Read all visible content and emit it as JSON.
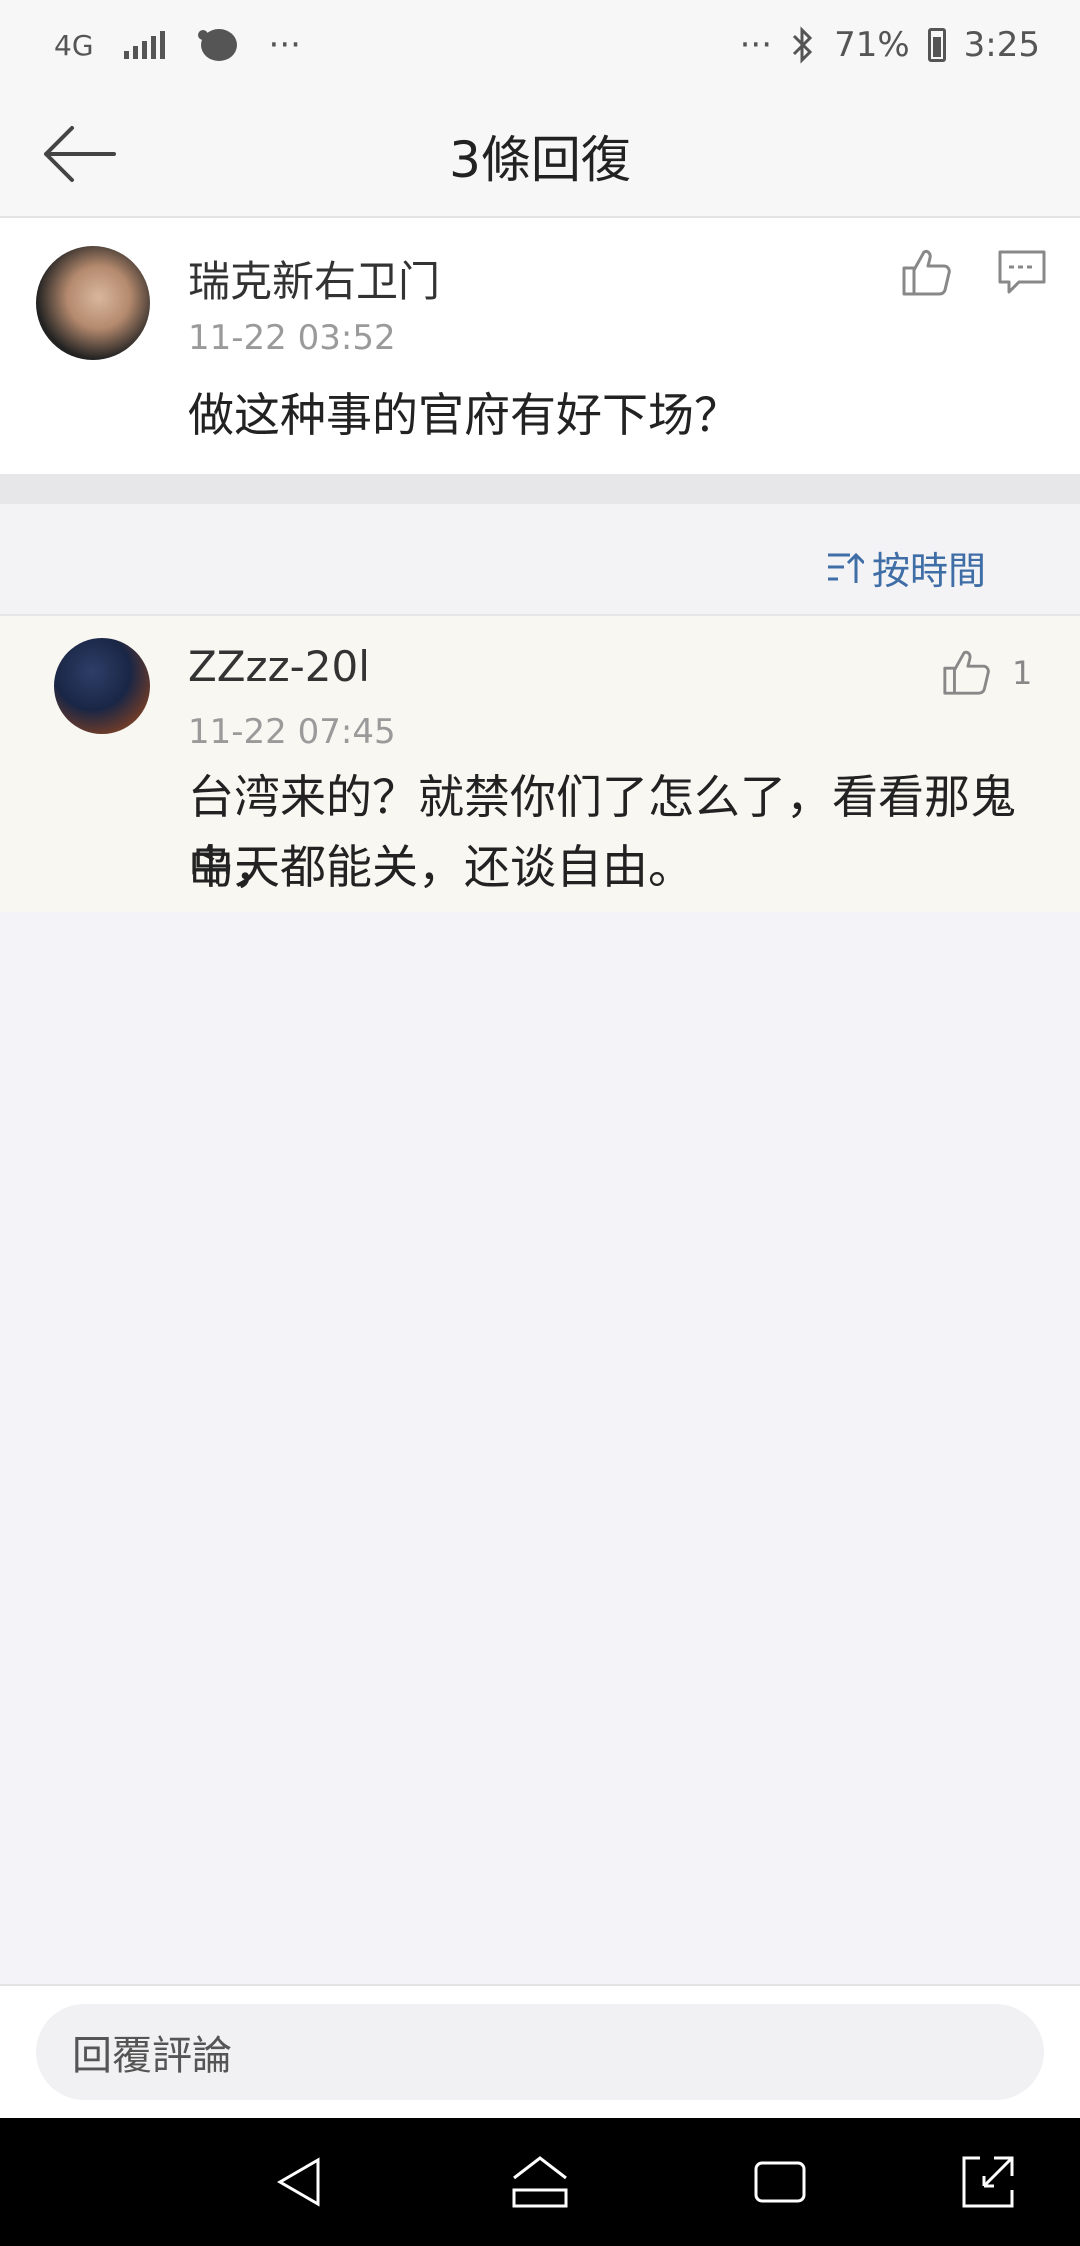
{
  "status_bar": {
    "network": "4G",
    "dots_left": "···",
    "dots_right": "···",
    "battery": "71%",
    "time": "3:25"
  },
  "header": {
    "title": "3條回復",
    "back_icon": "arrow-left-icon"
  },
  "main_comment": {
    "username": "瑞克新右卫门",
    "timestamp": "11-22 03:52",
    "text": "做这种事的官府有好下场？",
    "like_icon": "thumbs-up-icon",
    "comment_icon": "comment-icon"
  },
  "sort": {
    "label": "按時間",
    "icon": "sort-icon",
    "color": "#3f6da6"
  },
  "replies": [
    {
      "username": "ZZzz-20l",
      "timestamp": "11-22 07:45",
      "text_line1": "台湾来的？就禁你们了怎么了，看看那鬼岛，",
      "text_line2": "中天都能关，还谈自由。",
      "likes": "1"
    }
  ],
  "input": {
    "placeholder": "回覆評論"
  },
  "nav": {
    "back_icon": "nav-back-icon",
    "home_icon": "nav-home-icon",
    "recent_icon": "nav-recent-icon",
    "expand_icon": "nav-expand-icon"
  }
}
